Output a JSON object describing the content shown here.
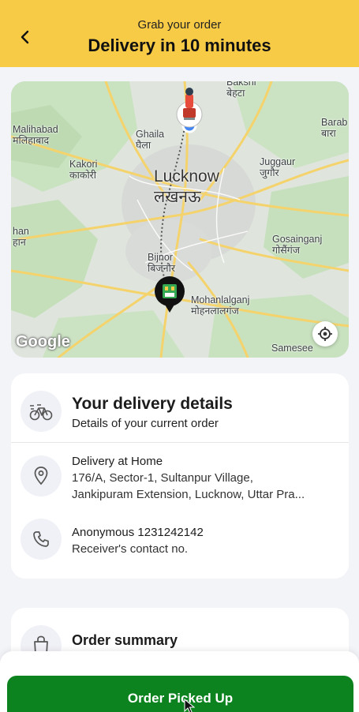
{
  "header": {
    "subtitle": "Grab your order",
    "title": "Delivery in 10 minutes",
    "back_icon": "back-arrow-icon",
    "background": "#f8cb46"
  },
  "map": {
    "labels": {
      "bakshi_en": "Bakshi",
      "bakshi_hi": "बेहटा",
      "malihabad_en": "Malihabad",
      "malihabad_hi": "मलिहाबाद",
      "ghaila_en": "Ghaila",
      "ghaila_hi": "घैला",
      "barab_en": "Barab",
      "barab_hi": "बारा",
      "kakori_en": "Kakori",
      "kakori_hi": "काकोरी",
      "lucknow_en": "Lucknow",
      "lucknow_hi": "लखनऊ",
      "juggaur_en": "Juggaur",
      "juggaur_hi": "जुगौर",
      "han_en": "han",
      "han_hi": "हान",
      "gosainganj_en": "Gosainganj",
      "gosainganj_hi": "गोसैंगंज",
      "bijnor_en": "Bijnor",
      "bijnor_hi": "बिजनौर",
      "mohanlalganj_en": "Mohanlalganj",
      "mohanlalganj_hi": "मोहनलालगंज",
      "samesee_en": "Samesee"
    },
    "logo": "Google",
    "recenter_icon": "crosshair-icon",
    "rider_icon": "delivery-rider-icon",
    "store_icon": "store-pin-icon"
  },
  "delivery_details": {
    "title": "Your delivery details",
    "subtitle": "Details of your current order",
    "header_icon": "bicycle-icon",
    "address": {
      "icon": "location-pin-icon",
      "title": "Delivery at Home",
      "line1": "176/A, Sector-1, Sultanpur Village,",
      "line2": "Jankipuram Extension, Lucknow, Uttar Pra..."
    },
    "contact": {
      "icon": "phone-icon",
      "name": "Anonymous 1231242142",
      "note": "Receiver's contact no."
    }
  },
  "order_summary": {
    "title": "Order summary",
    "icon": "shopping-bag-icon"
  },
  "cta": {
    "label": "Order Picked Up",
    "color": "#0c831f"
  }
}
